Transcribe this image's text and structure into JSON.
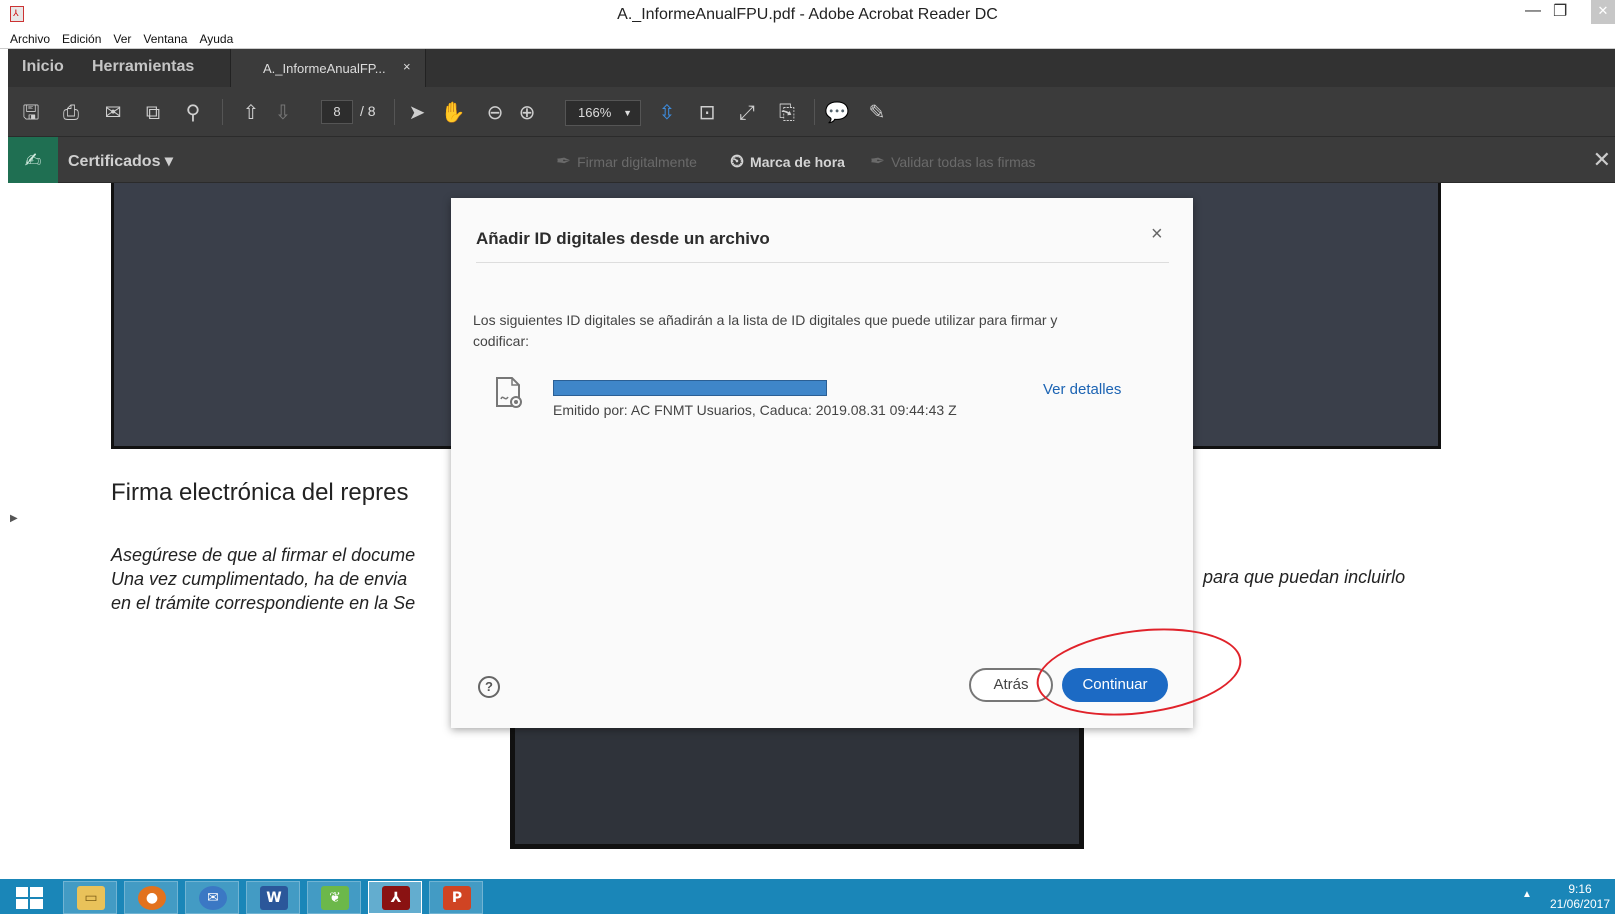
{
  "window": {
    "title": "A._InformeAnualFPU.pdf - Adobe Acrobat Reader DC",
    "close_glyph": "✕"
  },
  "menu": [
    "Archivo",
    "Edición",
    "Ver",
    "Ventana",
    "Ayuda"
  ],
  "tabs": {
    "home": "Inicio",
    "tools": "Herramientas",
    "document": "A._InformeAnualFP...",
    "document_close": "×"
  },
  "toolbar": {
    "current_page": "8",
    "total_pages": "/ 8",
    "zoom": "166%"
  },
  "cert_bar": {
    "label": "Certificados ▾",
    "sign": "Firmar digitalmente",
    "timestamp": "Marca de hora",
    "validate": "Validar todas las firmas",
    "close": "✕"
  },
  "document": {
    "heading": "Firma electrónica del repres",
    "para_line1": "Asegúrese de que al firmar el docume",
    "para_line2": "Una vez cumplimentado, ha de envia",
    "para_line3": "en el trámite correspondiente en la Se",
    "para_right": "para que puedan incluirlo"
  },
  "dialog": {
    "title": "Añadir ID digitales desde un archivo",
    "close": "×",
    "description": "Los siguientes ID digitales se añadirán a la lista de ID digitales que puede utilizar para firmar y codificar:",
    "issued": "Emitido por: AC FNMT Usuarios, Caduca: 2019.08.31 09:44:43 Z",
    "details_link": "Ver detalles",
    "help": "?",
    "back_button": "Atrás",
    "continue_button": "Continuar"
  },
  "taskbar": {
    "apps": [
      "file-explorer",
      "firefox",
      "thunderbird",
      "word",
      "green-app",
      "acrobat",
      "powerpoint"
    ],
    "time": "9:16",
    "date": "21/06/2017"
  },
  "colors": {
    "primary_button": "#1c6ac4",
    "link": "#1b63b3",
    "cert_accent": "#1f6f52",
    "taskbar": "#1a86b8",
    "annotation": "#e0222a"
  }
}
